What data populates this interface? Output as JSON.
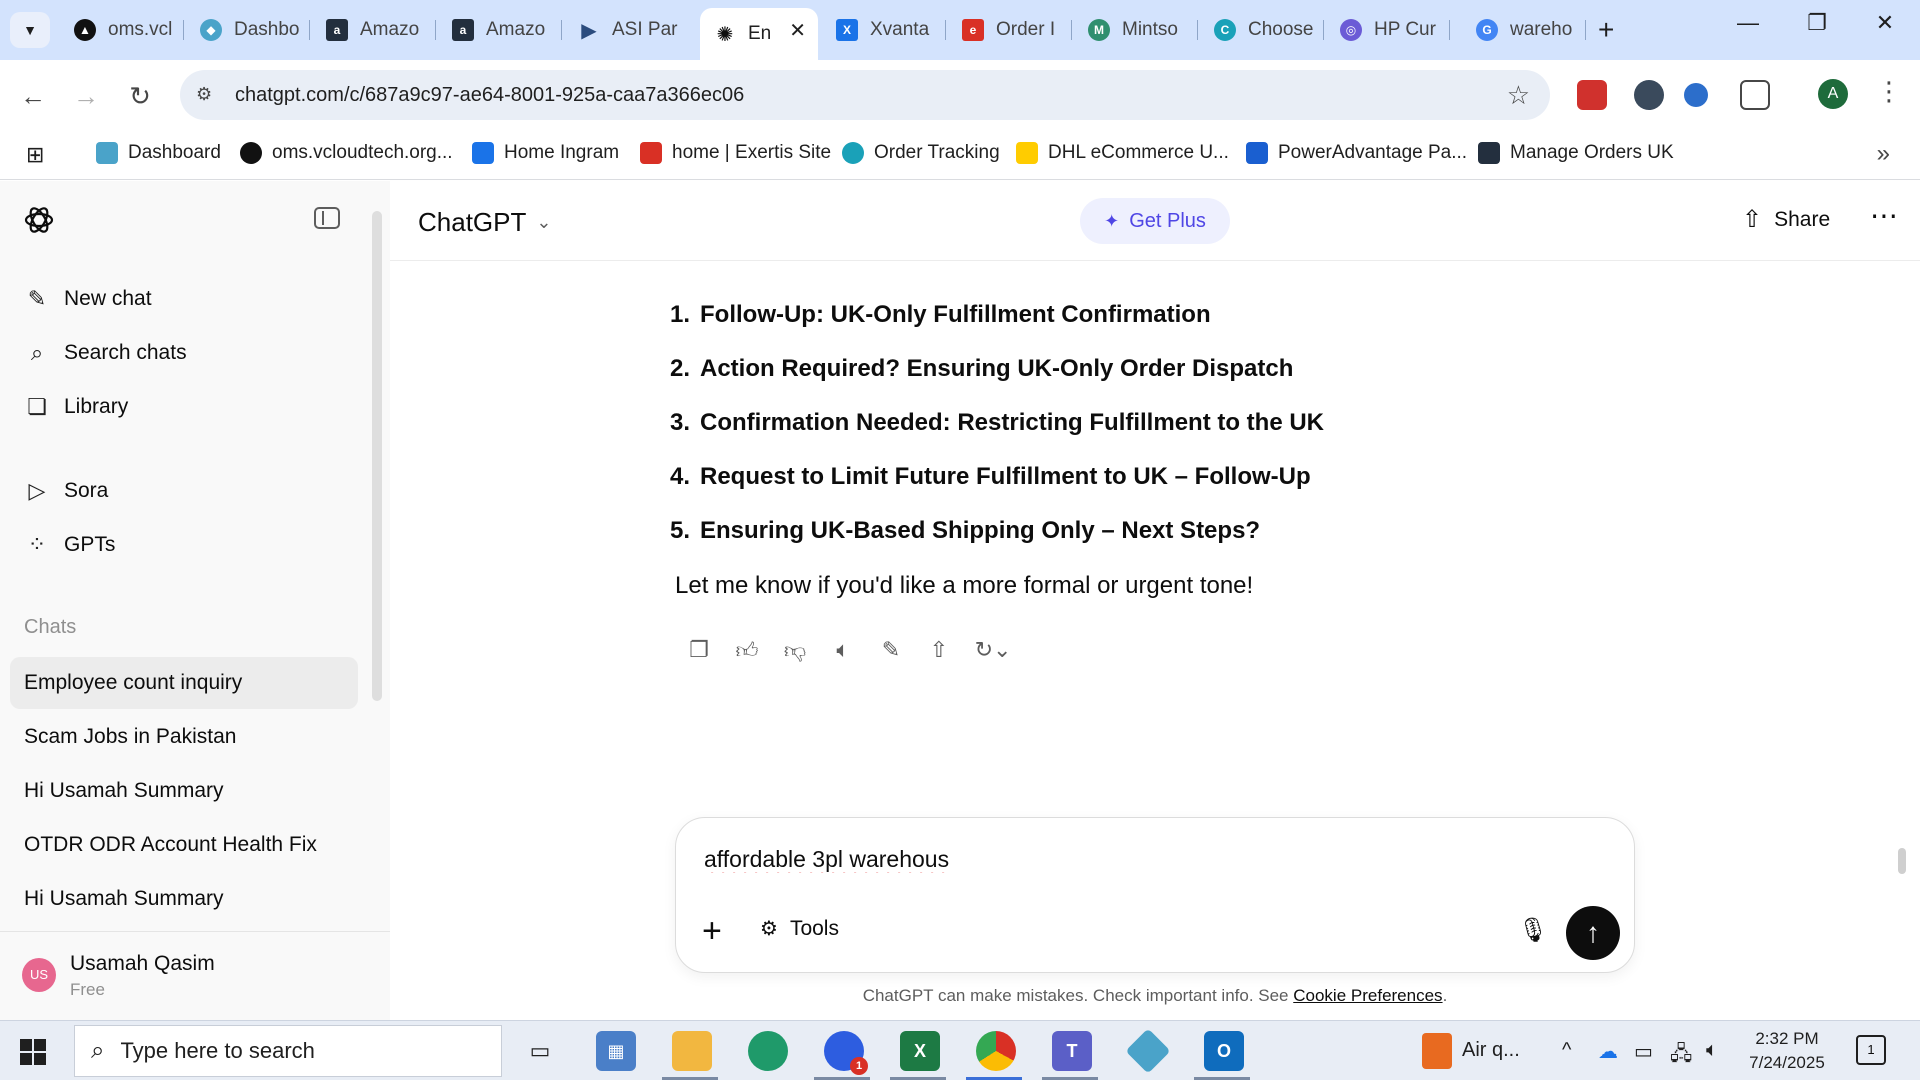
{
  "browser": {
    "tabs": [
      {
        "label": "oms.vcl",
        "color": "#111111",
        "glyph": "▲"
      },
      {
        "label": "Dashbo",
        "color": "#4aa3c9",
        "glyph": "◆"
      },
      {
        "label": "Amazo",
        "color": "#232f3e",
        "glyph": "a"
      },
      {
        "label": "Amazo",
        "color": "#232f3e",
        "glyph": "a"
      },
      {
        "label": "ASI Par",
        "color": "#2b4c7e",
        "glyph": "▶"
      },
      {
        "label": "En",
        "color": "#0d0d0d",
        "glyph": "✺"
      },
      {
        "label": "Xvanta",
        "color": "#1a73e8",
        "glyph": "X"
      },
      {
        "label": "Order I",
        "color": "#d93025",
        "glyph": "e"
      },
      {
        "label": "Mintso",
        "color": "#2f8f6f",
        "glyph": "M"
      },
      {
        "label": "Choose",
        "color": "#1aa1b8",
        "glyph": "C"
      },
      {
        "label": "HP Cur",
        "color": "#6b5bd6",
        "glyph": "◎"
      },
      {
        "label": "wareho",
        "color": "#4285f4",
        "glyph": "G"
      }
    ],
    "active_tab_close": "✕",
    "new_tab": "+",
    "window_controls": {
      "minimize": "—",
      "restore": "❐",
      "close": "✕"
    },
    "url": "chatgpt.com/c/687a9c97-ae64-8001-925a-caa7a366ec06",
    "profile_initial": "A",
    "bookmarks": [
      {
        "label": "Dashboard",
        "color": "#4aa3c9"
      },
      {
        "label": "oms.vcloudtech.org...",
        "color": "#111111"
      },
      {
        "label": "Home Ingram",
        "color": "#1a73e8"
      },
      {
        "label": "home | Exertis Site",
        "color": "#d93025"
      },
      {
        "label": "Order Tracking",
        "color": "#1aa1b8"
      },
      {
        "label": "DHL eCommerce U...",
        "color": "#ffcc00"
      },
      {
        "label": "PowerAdvantage Pa...",
        "color": "#1a5fd0"
      },
      {
        "label": "Manage Orders UK",
        "color": "#232f3e"
      }
    ]
  },
  "sidebar": {
    "nav": [
      {
        "label": "New chat",
        "icon": "✎"
      },
      {
        "label": "Search chats",
        "icon": "⌕"
      },
      {
        "label": "Library",
        "icon": "❏"
      },
      {
        "label": "Sora",
        "icon": "▷"
      },
      {
        "label": "GPTs",
        "icon": "⁘"
      }
    ],
    "chats_heading": "Chats",
    "chats": [
      "Employee count inquiry",
      "Scam Jobs in Pakistan",
      "Hi Usamah Summary",
      "OTDR ODR Account Health Fix",
      "Hi Usamah Summary"
    ],
    "user": {
      "initials": "US",
      "name": "Usamah Qasim",
      "plan": "Free"
    }
  },
  "header": {
    "model": "ChatGPT",
    "get_plus": "Get Plus",
    "share": "Share"
  },
  "conversation": {
    "subjects": [
      {
        "num": "1.",
        "text": "Follow-Up: UK-Only Fulfillment Confirmation"
      },
      {
        "num": "2.",
        "text": "Action Required? Ensuring UK-Only Order Dispatch"
      },
      {
        "num": "3.",
        "text": "Confirmation Needed: Restricting Fulfillment to the UK"
      },
      {
        "num": "4.",
        "text": "Request to Limit Future Fulfillment to UK – Follow-Up"
      },
      {
        "num": "5.",
        "text": "Ensuring UK-Based Shipping Only – Next Steps?"
      }
    ],
    "closing": "Let me know if you'd like a more formal or urgent tone!"
  },
  "composer": {
    "value": "affordable 3pl warehous",
    "tools_label": "Tools"
  },
  "disclaimer": {
    "text": "ChatGPT can make mistakes. Check important info. See ",
    "link": "Cookie Preferences",
    "end": "."
  },
  "taskbar": {
    "search_placeholder": "Type here to search",
    "weather": "Air q...",
    "time": "2:32 PM",
    "date": "7/24/2025",
    "notification_count": "1",
    "zoom_badge": "1"
  },
  "colors": {
    "accent_plus": "#4f46e5",
    "active_chat_bg": "#ececec",
    "tabstrip_bg": "#d3e3fd"
  }
}
